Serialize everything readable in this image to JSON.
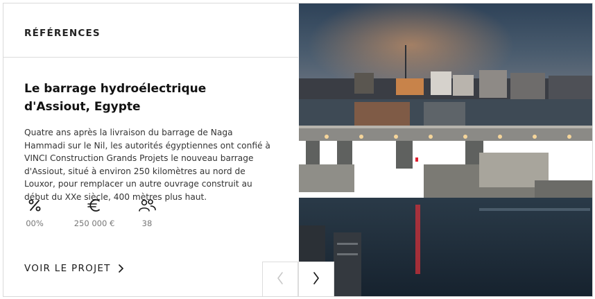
{
  "section": {
    "label": "RÉFÉRENCES"
  },
  "project": {
    "title": "Le barrage hydroélectrique d'Assiout, Egypte",
    "description": "Quatre ans après la livraison du barrage de Naga Hammadi sur le Nil, les autorités égyptiennes ont confié à VINCI Construction Grands Projets le nouveau barrage d'Assiout, situé à environ 250 kilomètres au nord de Louxor, pour remplacer un autre ouvrage construit au début du XXe siècle, 400 mètres plus haut."
  },
  "stats": [
    {
      "icon": "percent-icon",
      "value": "00%"
    },
    {
      "icon": "euro-icon",
      "value": "250 000 €"
    },
    {
      "icon": "people-icon",
      "value": "38"
    }
  ],
  "cta": {
    "label": "VOIR LE PROJET",
    "icon": "chevron-right-icon"
  },
  "carousel": {
    "prev_icon": "chevron-left-icon",
    "next_icon": "chevron-right-icon"
  },
  "colors": {
    "text": "#1a1a1a",
    "muted": "#777777",
    "border": "#dcdcdc",
    "disabled": "#c8c8c8"
  }
}
